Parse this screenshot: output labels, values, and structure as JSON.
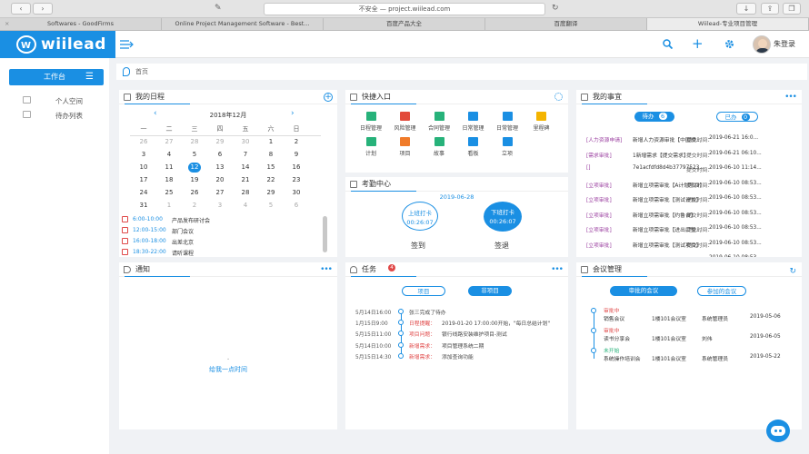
{
  "browser": {
    "url": "不安全 — project.wiilead.com",
    "tabs": [
      {
        "label": "Softwares - GoodFirms",
        "active": false
      },
      {
        "label": "Online Project Management Software - Best...",
        "active": false
      },
      {
        "label": "百度产品大全",
        "active": false
      },
      {
        "label": "百度翻译",
        "active": false
      },
      {
        "label": "Wiilead-专业项目管理",
        "active": true
      }
    ]
  },
  "app": {
    "logo_text": "wiilead",
    "user_name": "朱登录",
    "accent": "#1a8fe3"
  },
  "sidebar": {
    "workbench": "工作台",
    "items": [
      {
        "label": "个人空间",
        "icon": "personal-space-icon"
      },
      {
        "label": "待办列表",
        "icon": "todo-list-icon"
      }
    ]
  },
  "breadcrumb": {
    "home": "首页"
  },
  "schedule": {
    "title": "我的日程",
    "month": "2018年12月",
    "weekdays": [
      "一",
      "二",
      "三",
      "四",
      "五",
      "六",
      "日"
    ],
    "weeks": [
      [
        {
          "d": "26",
          "m": false
        },
        {
          "d": "27",
          "m": false
        },
        {
          "d": "28",
          "m": false
        },
        {
          "d": "29",
          "m": false
        },
        {
          "d": "30",
          "m": false
        },
        {
          "d": "1",
          "m": true
        },
        {
          "d": "2",
          "m": true
        }
      ],
      [
        {
          "d": "3",
          "m": true
        },
        {
          "d": "4",
          "m": true
        },
        {
          "d": "5",
          "m": true
        },
        {
          "d": "6",
          "m": true
        },
        {
          "d": "7",
          "m": true
        },
        {
          "d": "8",
          "m": true
        },
        {
          "d": "9",
          "m": true
        }
      ],
      [
        {
          "d": "10",
          "m": true
        },
        {
          "d": "11",
          "m": true
        },
        {
          "d": "12",
          "m": true,
          "today": true
        },
        {
          "d": "13",
          "m": true
        },
        {
          "d": "14",
          "m": true
        },
        {
          "d": "15",
          "m": true
        },
        {
          "d": "16",
          "m": true
        }
      ],
      [
        {
          "d": "17",
          "m": true
        },
        {
          "d": "18",
          "m": true
        },
        {
          "d": "19",
          "m": true
        },
        {
          "d": "20",
          "m": true
        },
        {
          "d": "21",
          "m": true
        },
        {
          "d": "22",
          "m": true
        },
        {
          "d": "23",
          "m": true
        }
      ],
      [
        {
          "d": "24",
          "m": true
        },
        {
          "d": "25",
          "m": true
        },
        {
          "d": "26",
          "m": true
        },
        {
          "d": "27",
          "m": true
        },
        {
          "d": "28",
          "m": true
        },
        {
          "d": "29",
          "m": true
        },
        {
          "d": "30",
          "m": true
        }
      ],
      [
        {
          "d": "31",
          "m": true
        },
        {
          "d": "1",
          "m": false
        },
        {
          "d": "2",
          "m": false
        },
        {
          "d": "3",
          "m": false
        },
        {
          "d": "4",
          "m": false
        },
        {
          "d": "5",
          "m": false
        },
        {
          "d": "6",
          "m": false
        }
      ]
    ],
    "events": [
      {
        "time": "6:00-10:00",
        "name": "产品发布研讨会"
      },
      {
        "time": "12:00-15:00",
        "name": "部门会议"
      },
      {
        "time": "16:00-18:00",
        "name": "出差北京"
      },
      {
        "time": "18:30-22:00",
        "name": "请听课程"
      }
    ]
  },
  "quick": {
    "title": "快捷入口",
    "items": [
      {
        "label": "日程管理",
        "color": "#27b27a"
      },
      {
        "label": "风险管理",
        "color": "#e24a3b"
      },
      {
        "label": "合同管理",
        "color": "#27b27a"
      },
      {
        "label": "日常管理",
        "color": "#1a8fe3"
      },
      {
        "label": "日常管理",
        "color": "#1a8fe3"
      },
      {
        "label": "里程碑",
        "color": "#f4b400"
      },
      {
        "label": "计划",
        "color": "#27b27a"
      },
      {
        "label": "项目",
        "color": "#f07b2a"
      },
      {
        "label": "故事",
        "color": "#27b27a"
      },
      {
        "label": "看板",
        "color": "#1a8fe3"
      },
      {
        "label": "立项",
        "color": "#1a8fe3"
      }
    ]
  },
  "attendance": {
    "title": "考勤中心",
    "date": "2019-06-28",
    "checkin": {
      "label": "上班打卡",
      "time": "00:26:07",
      "action": "签到"
    },
    "checkout": {
      "label": "下班打卡",
      "time": "00:26:07",
      "action": "签退"
    }
  },
  "matters": {
    "title": "我的事宜",
    "tab_todo": "待办",
    "tab_todo_count": "6",
    "tab_done": "已办",
    "tab_done_count": "0",
    "rows": [
      {
        "tag": "[人力资源申请]",
        "text": "新增人力资源审批【中国燃...",
        "status": "提交时间：",
        "date": "2019-06-21 16:0..."
      },
      {
        "tag": "[需求审批]",
        "text": "1新增需求【提交需求】",
        "status": "提交时间：",
        "date": "2019-06-21 06:10..."
      },
      {
        "tag": "[]",
        "text": "7e1acfdfd8d4b37797523...",
        "status": "提交时间：",
        "date": "2019-06-10 11:14..."
      },
      {
        "tag": "[立项审批]",
        "text": "新增立项需审批【A计划项目】",
        "status": "提交时间：",
        "date": "2019-06-10 08:53..."
      },
      {
        "tag": "[立项审批]",
        "text": "新增立项需审批【测试计划】",
        "status": "提交时间：",
        "date": "2019-06-10 08:53..."
      },
      {
        "tag": "[立项审批]",
        "text": "新增立项需审批【约鲁台】",
        "status": "提交时间：",
        "date": "2019-06-10 08:53..."
      },
      {
        "tag": "[立项审批]",
        "text": "新增立项需审批【进出口整...",
        "status": "提交时间：",
        "date": "2019-06-10 08:53..."
      },
      {
        "tag": "[立项审批]",
        "text": "新增立项需审批【测试项目】",
        "status": "提交时间：",
        "date": "2019-06-10 08:53..."
      },
      {
        "tag": "[立项审批]",
        "text": "新增立项需审批【A计划...",
        "status": "提交时间：",
        "date": "2019-06-10 08:53..."
      }
    ]
  },
  "notice": {
    "title": "通知",
    "empty_text": "给我一点时间"
  },
  "tasks": {
    "title": "任务",
    "badge": "4",
    "tab_project": "项目",
    "tab_nonproject": "非项目",
    "rows": [
      {
        "time": "5月14日16:00",
        "cat": "",
        "desc": "张三完成了待办"
      },
      {
        "time": "1月15日9:00",
        "cat": "日程提醒：",
        "desc": "2019-01-20 17:00:00开始，\"每日总结计划\""
      },
      {
        "time": "5月15日11:00",
        "cat": "项目问题：",
        "desc": "银行线路安装维护项目-测试"
      },
      {
        "time": "5月14日10:00",
        "cat": "新增需求：",
        "desc": "项目管理系统二期"
      },
      {
        "time": "5月15日14:30",
        "cat": "新增需求：",
        "desc": "添加查询功能"
      }
    ]
  },
  "meetings": {
    "title": "会议管理",
    "tab_approving": "审批的会议",
    "tab_joined": "参加的会议",
    "rows": [
      {
        "status": "审批中",
        "name": "销售会议",
        "room": "1楼101会议室",
        "person": "系统管理员",
        "date": "2019-05-06"
      },
      {
        "status": "审批中",
        "name": "读书分享会",
        "room": "1楼101会议室",
        "person": "刘伟",
        "date": "2019-06-05"
      },
      {
        "status": "未开始",
        "name": "系统操作培训会",
        "room": "1楼101会议室",
        "person": "系统管理员",
        "date": "2019-05-22"
      }
    ]
  }
}
